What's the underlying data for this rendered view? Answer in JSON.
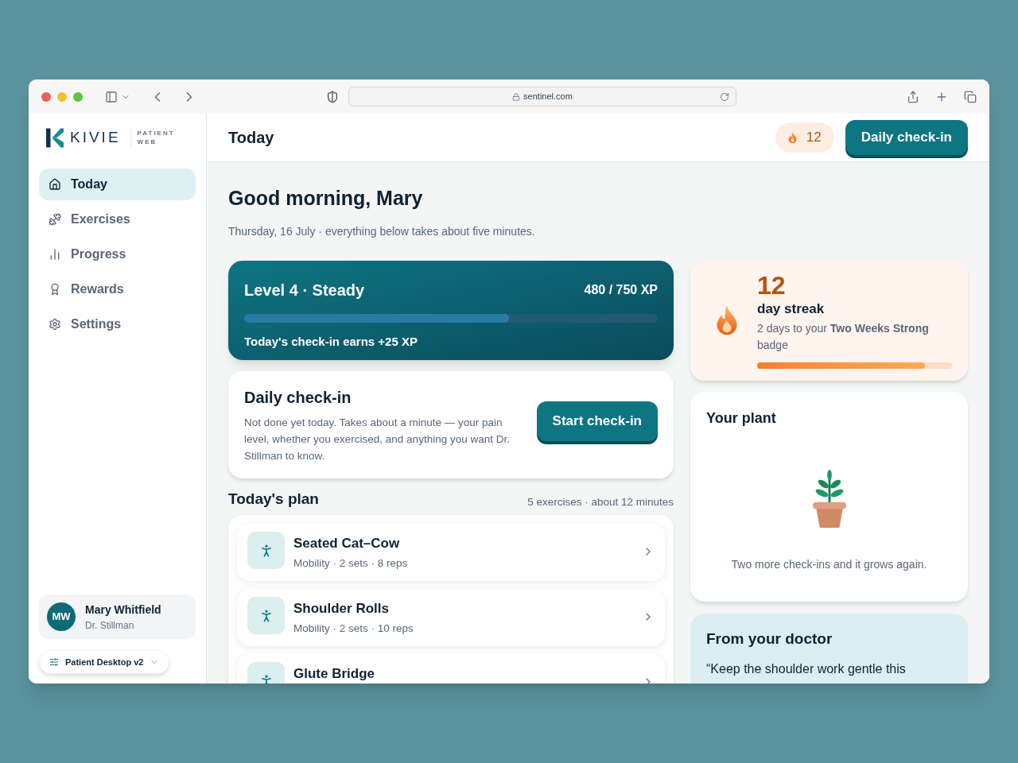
{
  "browser": {
    "url": "sentinel.com"
  },
  "sidebar": {
    "logo": {
      "wordmark": "KIVIE",
      "sub_1": "PATIENT",
      "sub_2": "WEB"
    },
    "nav": [
      {
        "label": "Today",
        "selected": true
      },
      {
        "label": "Exercises",
        "selected": false
      },
      {
        "label": "Progress",
        "selected": false
      },
      {
        "label": "Rewards",
        "selected": false
      },
      {
        "label": "Settings",
        "selected": false
      }
    ],
    "user": {
      "initials": "MW",
      "name": "Mary Whitfield",
      "doctor": "Dr. Stillman"
    },
    "version": {
      "label": "Patient Desktop v2"
    }
  },
  "header": {
    "title": "Today",
    "streak": "12",
    "button": "Daily check-in"
  },
  "greeting": "Good morning, Mary",
  "subtitle": "Thursday, 16 July · everything below takes about five minutes.",
  "level_card": {
    "title": "Level 4 · Steady",
    "xp": "480 / 750 XP",
    "level": 0.64,
    "note": "Today's check-in earns +25 XP"
  },
  "checkin_card": {
    "title": "Daily check-in",
    "text": "Not done yet today. Takes about a minute — your pain level, whether you exercised, and anything you want Dr. Stillman to know.",
    "button": "Start check-in"
  },
  "plan": {
    "title": "Today's plan",
    "summary": "5 exercises · about 12 minutes",
    "exercises": [
      {
        "name": "Seated Cat–Cow",
        "details": "Mobility · 2 sets · 8 reps"
      },
      {
        "name": "Shoulder Rolls",
        "details": "Mobility · 2 sets · 10 reps"
      },
      {
        "name": "Glute Bridge"
      }
    ]
  },
  "streak_card": {
    "count": "12",
    "label": "day streak",
    "text": "2 days to your **Two Weeks Strong** badge",
    "level": 0.86
  },
  "plant_card": {
    "title": "Your plant",
    "caption": "Two more check-ins and it grows again."
  },
  "doctor_card": {
    "title": "From your doctor",
    "quote": "“Keep the shoulder work gentle this"
  }
}
